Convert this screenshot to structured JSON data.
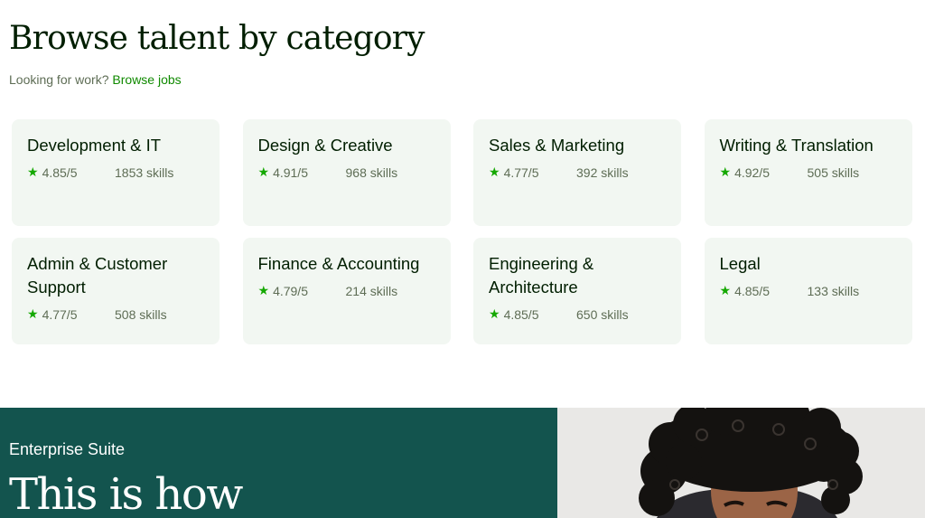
{
  "header": {
    "title": "Browse talent by category",
    "subtitle_prefix": "Looking for work?",
    "subtitle_link": "Browse jobs"
  },
  "categories": [
    {
      "name": "Development & IT",
      "rating": "4.85/5",
      "skills": "1853 skills"
    },
    {
      "name": "Design & Creative",
      "rating": "4.91/5",
      "skills": "968 skills"
    },
    {
      "name": "Sales & Marketing",
      "rating": "4.77/5",
      "skills": "392 skills"
    },
    {
      "name": "Writing & Translation",
      "rating": "4.92/5",
      "skills": "505 skills"
    },
    {
      "name": "Admin & Customer Support",
      "rating": "4.77/5",
      "skills": "508 skills"
    },
    {
      "name": "Finance & Accounting",
      "rating": "4.79/5",
      "skills": "214 skills"
    },
    {
      "name": "Engineering & Architecture",
      "rating": "4.85/5",
      "skills": "650 skills"
    },
    {
      "name": "Legal",
      "rating": "4.85/5",
      "skills": "133 skills"
    }
  ],
  "star_glyph": "★",
  "enterprise": {
    "eyebrow": "Enterprise Suite",
    "headline": "This is how"
  },
  "colors": {
    "accent_green": "#14a800",
    "card_bg": "#f2f7f2",
    "banner_bg": "#13544e",
    "text_dark": "#001e00"
  }
}
